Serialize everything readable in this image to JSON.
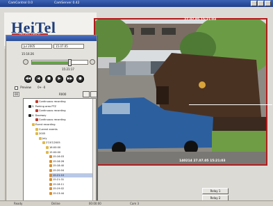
{
  "window": {
    "title": "CamControl 0.0",
    "camera_title": "CamServer 0.42"
  },
  "logo": {
    "brand": "HeiTel",
    "sub": "DIGITAL VIDEO"
  },
  "video": {
    "overlay_title": "27.07.05 15:21:03",
    "timestamp": "140214 27.07.05 15:21:03"
  },
  "controls": {
    "date_field": "Jul 2005",
    "date_field2": "15.07.05",
    "time_readout": "15:16:26",
    "time_end": "15:21:17",
    "slider_position": 0.68,
    "playback_buttons": [
      "◀◀",
      "◀",
      "■",
      "▶",
      "▶▶",
      "●"
    ],
    "checkbox_label": "Preview",
    "checkbox_value": "0+  -0",
    "speed_label": "00",
    "speed_value": "R000"
  },
  "tree": {
    "items": [
      {
        "depth": 3,
        "icon": "red",
        "label": "Continuous recording"
      },
      {
        "depth": 1,
        "icon": "black",
        "label": "3. Parking area PTZ"
      },
      {
        "depth": 3,
        "icon": "red",
        "label": "Continuous recording"
      },
      {
        "depth": 1,
        "icon": "black",
        "label": "4. Doorway"
      },
      {
        "depth": 3,
        "icon": "red",
        "label": "Continuous recording"
      },
      {
        "depth": 2,
        "icon": "fold",
        "label": "Event recording"
      },
      {
        "depth": 3,
        "icon": "fold",
        "label": "Current events"
      },
      {
        "depth": 3,
        "icon": "fold",
        "label": "2005"
      },
      {
        "depth": 4,
        "icon": "fold",
        "label": "July"
      },
      {
        "depth": 5,
        "icon": "fold",
        "label": "27/07/2005"
      },
      {
        "depth": 6,
        "icon": "fold",
        "label": "16:00:00"
      },
      {
        "depth": 6,
        "icon": "fold",
        "label": "15:00:00"
      },
      {
        "depth": 7,
        "icon": "clip",
        "label": "15:16:03"
      },
      {
        "depth": 7,
        "icon": "clip",
        "label": "15:16:26"
      },
      {
        "depth": 7,
        "icon": "clip",
        "label": "15:18:40"
      },
      {
        "depth": 7,
        "icon": "clip",
        "label": "15:20:04"
      },
      {
        "depth": 7,
        "icon": "clip",
        "label": "15:21:10",
        "selected": true
      },
      {
        "depth": 7,
        "icon": "clip",
        "label": "15:21:31"
      },
      {
        "depth": 7,
        "icon": "clip",
        "label": "15:18:11"
      },
      {
        "depth": 7,
        "icon": "clip",
        "label": "15:19:02"
      },
      {
        "depth": 7,
        "icon": "clip",
        "label": "15:13:44"
      }
    ]
  },
  "bottom_buttons": [
    "Relay 1",
    "Relay 2"
  ],
  "statusbar": [
    "Ready",
    "Online",
    "00:00:00",
    "Cam 3"
  ]
}
